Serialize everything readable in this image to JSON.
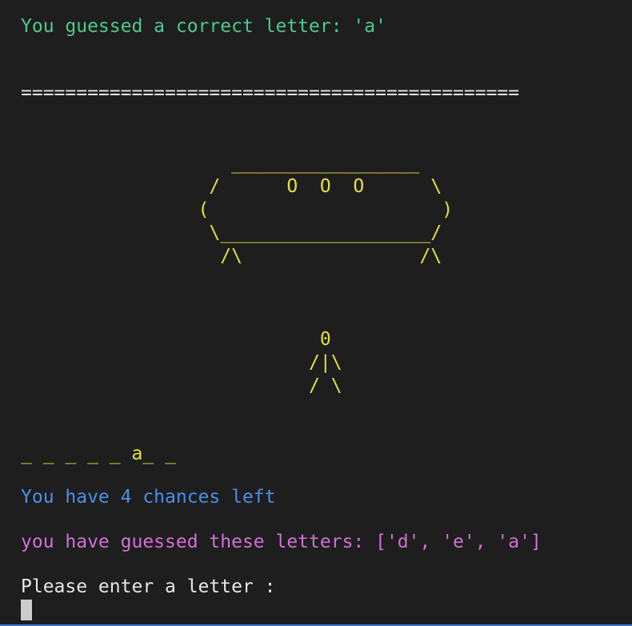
{
  "terminal": {
    "feedback": "You guessed a correct letter: 'a'",
    "separator": "=============================================",
    "ufo_art": "                   _________________\n                 /      O  O  O      \\\n                (                     )\n                 \\___________________/\n                  /\\                /\\",
    "figure_art": "                           0\n                          /|\\\n                          / \\",
    "word_display": "_ _ _ _ _ a_ _",
    "chances": "You have 4 chances left",
    "guessed_letters": "you have guessed these letters: ['d', 'e', 'a']",
    "prompt": "Please enter a letter :"
  },
  "colors": {
    "background": "#1e1e1e",
    "green": "#4ec98f",
    "yellow": "#e5e03a",
    "blue": "#4b8fe8",
    "magenta": "#d36fd6",
    "white": "#e6e6e6"
  }
}
